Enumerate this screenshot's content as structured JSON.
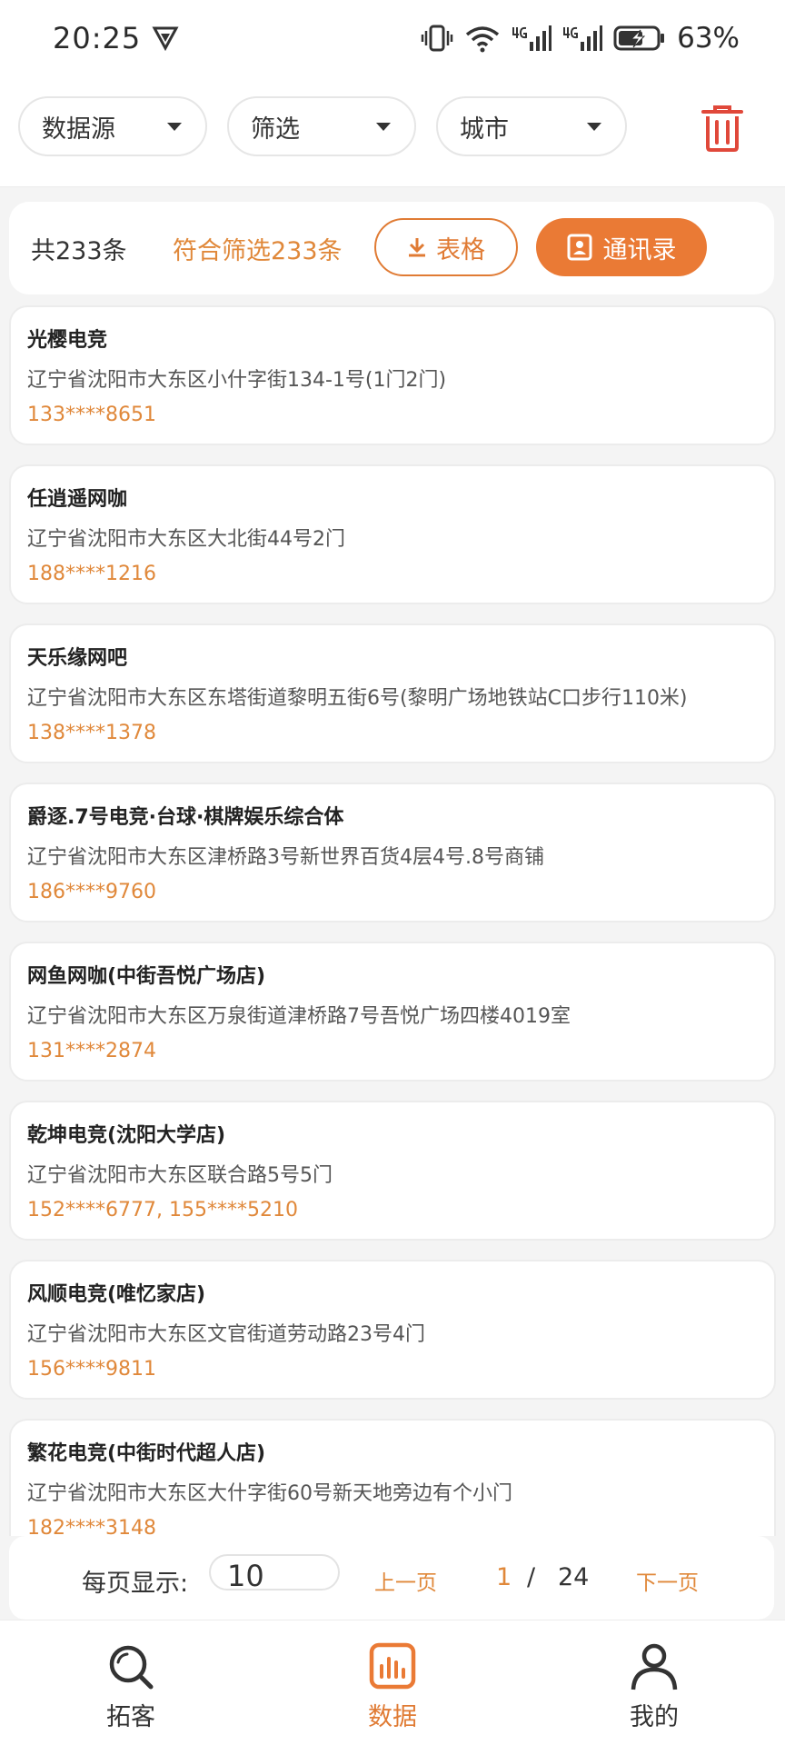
{
  "status": {
    "time": "20:25",
    "battery": "63%"
  },
  "filters": {
    "source_label": "数据源",
    "filter_label": "筛选",
    "city_label": "城市"
  },
  "summary": {
    "total": "共233条",
    "matched": "符合筛选233条",
    "table_button": "表格",
    "contacts_button": "通讯录"
  },
  "records": [
    {
      "name": "光樱电竞",
      "address": "辽宁省沈阳市大东区小什字街134-1号(1门2门)",
      "phone": "133****8651"
    },
    {
      "name": "任逍遥网咖",
      "address": "辽宁省沈阳市大东区大北街44号2门",
      "phone": "188****1216"
    },
    {
      "name": "天乐缘网吧",
      "address": "辽宁省沈阳市大东区东塔街道黎明五街6号(黎明广场地铁站C口步行110米)",
      "phone": "138****1378"
    },
    {
      "name": "爵逐.7号电竞·台球·棋牌娱乐综合体",
      "address": "辽宁省沈阳市大东区津桥路3号新世界百货4层4号.8号商铺",
      "phone": "186****9760"
    },
    {
      "name": "网鱼网咖(中街吾悦广场店)",
      "address": "辽宁省沈阳市大东区万泉街道津桥路7号吾悦广场四楼4019室",
      "phone": "131****2874"
    },
    {
      "name": "乾坤电竞(沈阳大学店)",
      "address": "辽宁省沈阳市大东区联合路5号5门",
      "phone": "152****6777, 155****5210"
    },
    {
      "name": "风顺电竞(唯忆家店)",
      "address": "辽宁省沈阳市大东区文官街道劳动路23号4门",
      "phone": "156****9811"
    },
    {
      "name": "繁花电竞(中街时代超人店)",
      "address": "辽宁省沈阳市大东区大什字街60号新天地旁边有个小门",
      "phone": "182****3148"
    }
  ],
  "pager": {
    "per_page_label": "每页显示:",
    "per_page_value": "10",
    "prev_label": "上一页",
    "current_page": "1",
    "separator": "/",
    "total_pages": "24",
    "next_label": "下一页"
  },
  "tabs": {
    "prospect": "拓客",
    "data": "数据",
    "mine": "我的"
  },
  "colors": {
    "accent": "#ea7a35",
    "accent_text": "#e0883a",
    "trash": "#e0483a"
  }
}
